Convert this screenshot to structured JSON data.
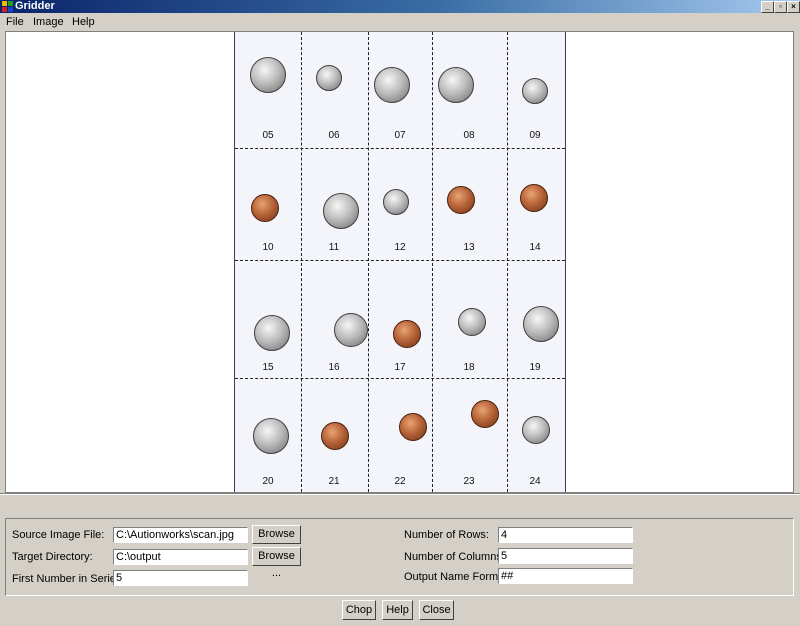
{
  "window": {
    "title": "Gridder"
  },
  "menu": [
    "File",
    "Image",
    "Help"
  ],
  "scan": {
    "labels": [
      "05",
      "06",
      "07",
      "08",
      "09",
      "10",
      "11",
      "12",
      "13",
      "14",
      "15",
      "16",
      "17",
      "18",
      "19",
      "20",
      "21",
      "22",
      "23",
      "24"
    ]
  },
  "form": {
    "source_label": "Source Image File:",
    "source_value": "C:\\Autionworks\\scan.jpg",
    "target_label": "Target Directory:",
    "target_value": "C:\\output",
    "first_label": "First Number in Series:",
    "first_value": "5",
    "rows_label": "Number of Rows:",
    "rows_value": "4",
    "cols_label": "Number of Columns:",
    "cols_value": "5",
    "format_label": "Output Name Format:",
    "format_value": "##",
    "browse_label": "Browse ..."
  },
  "buttons": {
    "chop": "Chop",
    "help": "Help",
    "close": "Close"
  }
}
